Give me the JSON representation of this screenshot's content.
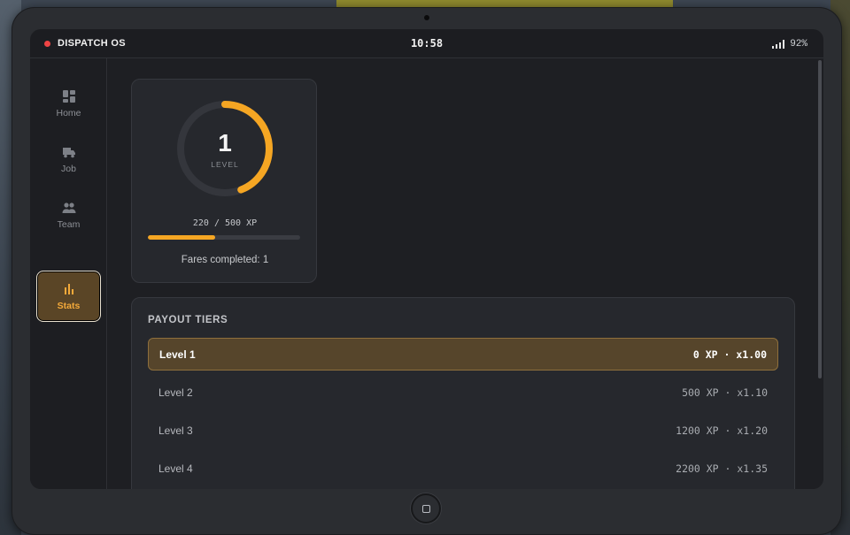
{
  "status_bar": {
    "app_name": "DISPATCH OS",
    "time": "10:58",
    "battery": "92%"
  },
  "sidebar": {
    "items": [
      {
        "label": "Home",
        "icon": "dashboard-icon",
        "active": false
      },
      {
        "label": "Job",
        "icon": "truck-icon",
        "active": false
      },
      {
        "label": "Team",
        "icon": "people-icon",
        "active": false
      },
      {
        "label": "Stats",
        "icon": "bar-chart-icon",
        "active": true
      }
    ]
  },
  "level_card": {
    "level": "1",
    "level_label": "LEVEL",
    "xp_text": "220 / 500 XP",
    "xp_progress": 0.44,
    "fares_text": "Fares completed: 1"
  },
  "tiers": {
    "title": "PAYOUT TIERS",
    "rows": [
      {
        "name": "Level 1",
        "value": "0 XP · x1.00",
        "current": true
      },
      {
        "name": "Level 2",
        "value": "500 XP · x1.10",
        "current": false
      },
      {
        "name": "Level 3",
        "value": "1200 XP · x1.20",
        "current": false
      },
      {
        "name": "Level 4",
        "value": "2200 XP · x1.35",
        "current": false
      }
    ]
  },
  "colors": {
    "accent": "#f5a623",
    "active_nav_bg": "#5a4526",
    "record_dot": "#ef4444"
  }
}
